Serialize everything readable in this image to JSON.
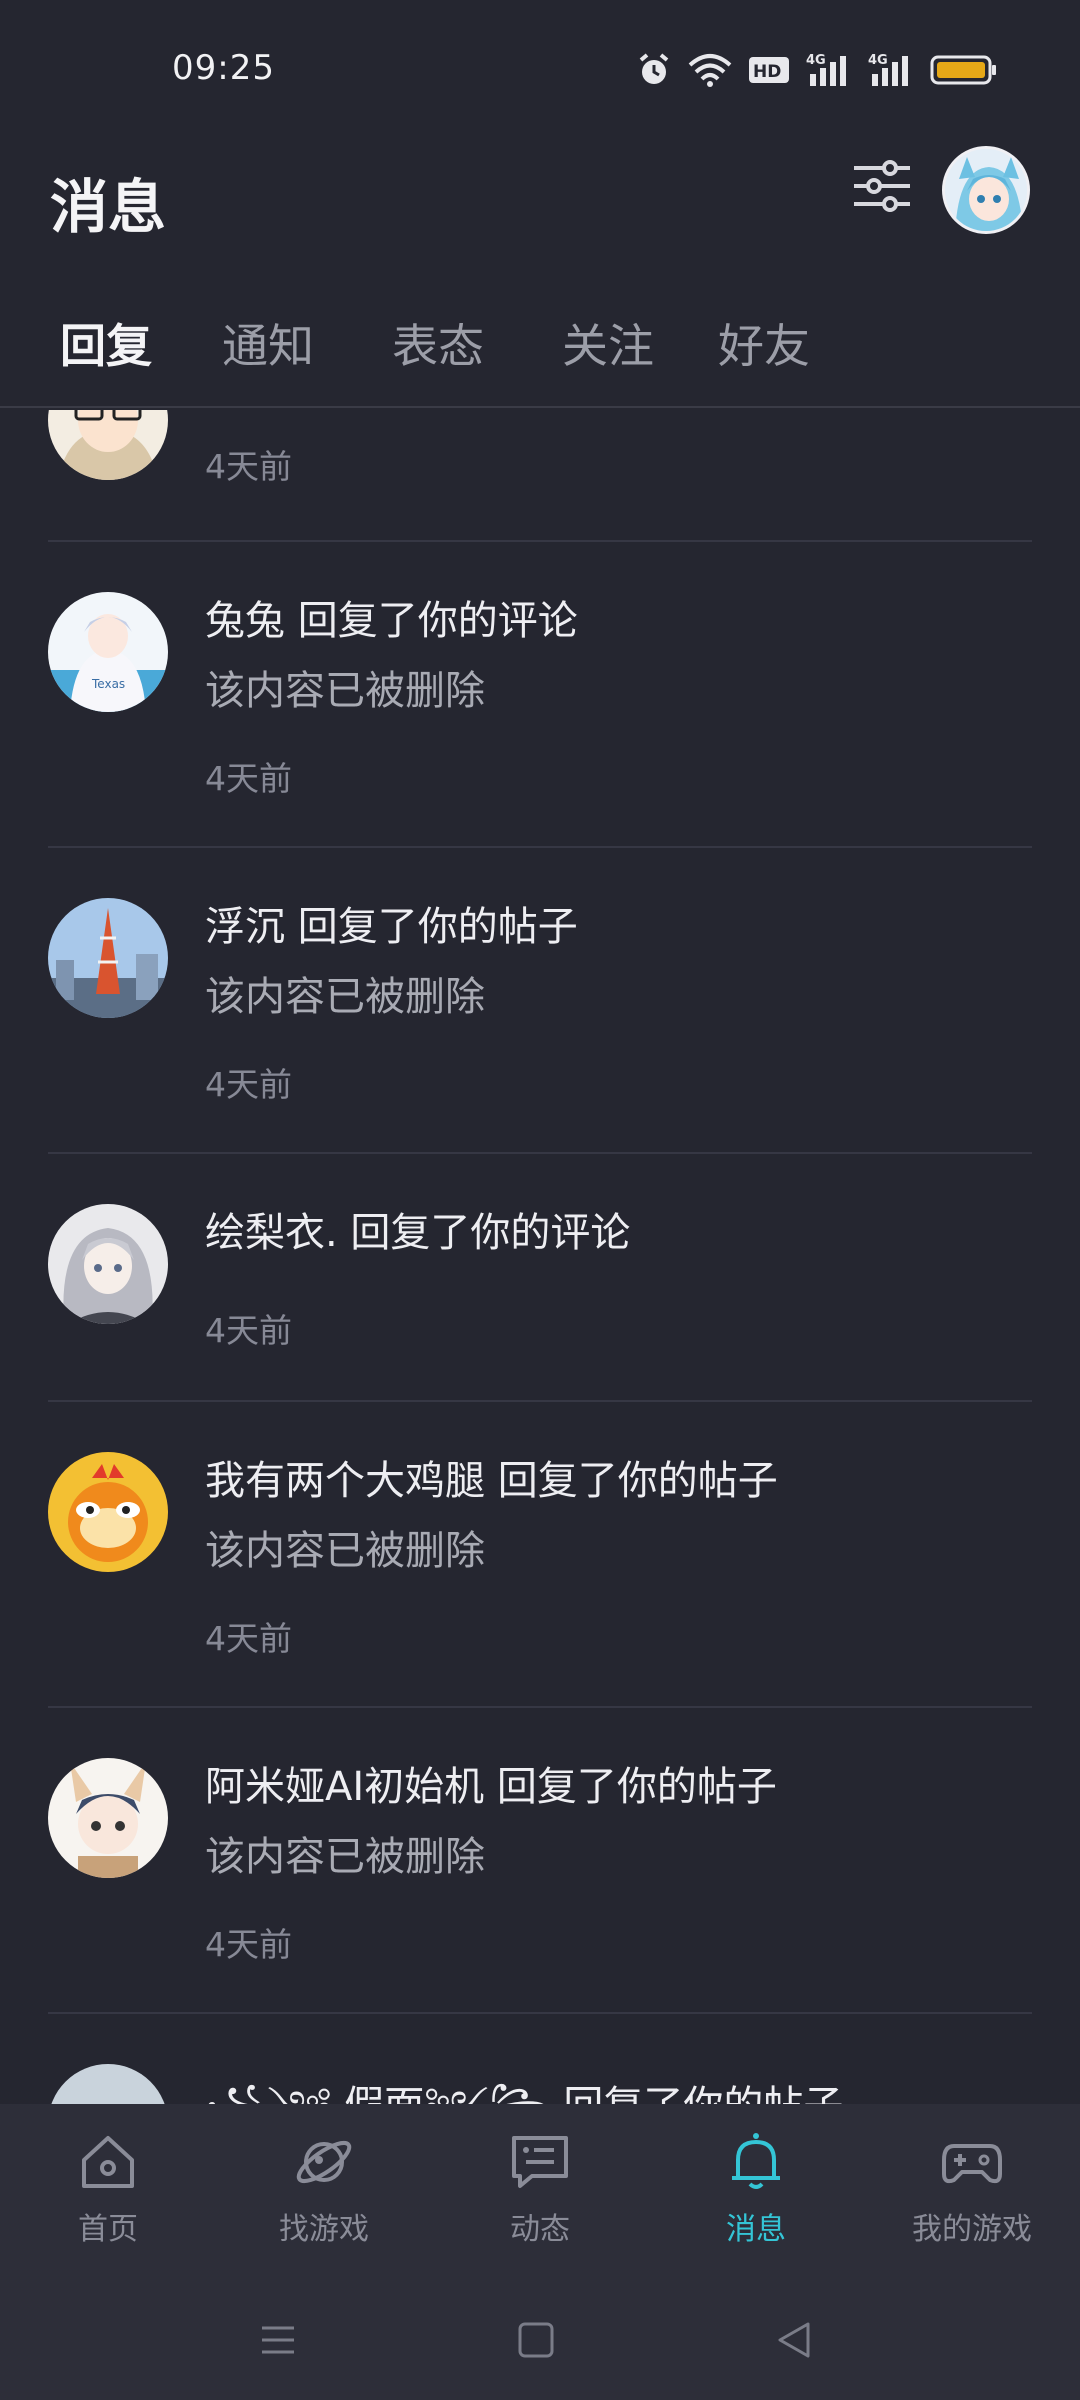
{
  "status_bar": {
    "time": "09:25",
    "icons": [
      "alarm-icon",
      "wifi-icon",
      "hd-icon",
      "signal-4g-icon",
      "signal-4g-icon",
      "battery-icon"
    ],
    "hd_label": "HD",
    "net_label": "4G",
    "battery_color": "#e6a817"
  },
  "header": {
    "title": "消息",
    "filter_icon": "sliders-icon"
  },
  "tabs": [
    {
      "label": "回复",
      "active": true
    },
    {
      "label": "通知",
      "active": false
    },
    {
      "label": "表态",
      "active": false
    },
    {
      "label": "关注",
      "active": false
    },
    {
      "label": "好友",
      "active": false
    }
  ],
  "messages": [
    {
      "title": "",
      "subtitle": "",
      "time": "4天前"
    },
    {
      "title": "兔兔 回复了你的评论",
      "subtitle": "该内容已被删除",
      "time": "4天前"
    },
    {
      "title": "浮沉 回复了你的帖子",
      "subtitle": "该内容已被删除",
      "time": "4天前"
    },
    {
      "title": "绘梨衣. 回复了你的评论",
      "subtitle": "",
      "time": "4天前"
    },
    {
      "title": "我有两个大鸡腿 回复了你的帖子",
      "subtitle": "该内容已被删除",
      "time": "4天前"
    },
    {
      "title": "阿米娅AI初始机 回复了你的帖子",
      "subtitle": "该内容已被删除",
      "time": "4天前"
    },
    {
      "title": "꧁༺ 假面༻꧂ 回复了你的帖子",
      "subtitle": "",
      "time": ""
    }
  ],
  "bottom_nav": [
    {
      "label": "首页",
      "icon": "home-icon",
      "active": false
    },
    {
      "label": "找游戏",
      "icon": "planet-icon",
      "active": false
    },
    {
      "label": "动态",
      "icon": "chat-bubble-icon",
      "active": false
    },
    {
      "label": "消息",
      "icon": "bell-icon",
      "active": true
    },
    {
      "label": "我的游戏",
      "icon": "gamepad-icon",
      "active": false
    }
  ],
  "colors": {
    "background": "#252630",
    "accent": "#34c5d6",
    "nav_background": "#2d2e39"
  }
}
